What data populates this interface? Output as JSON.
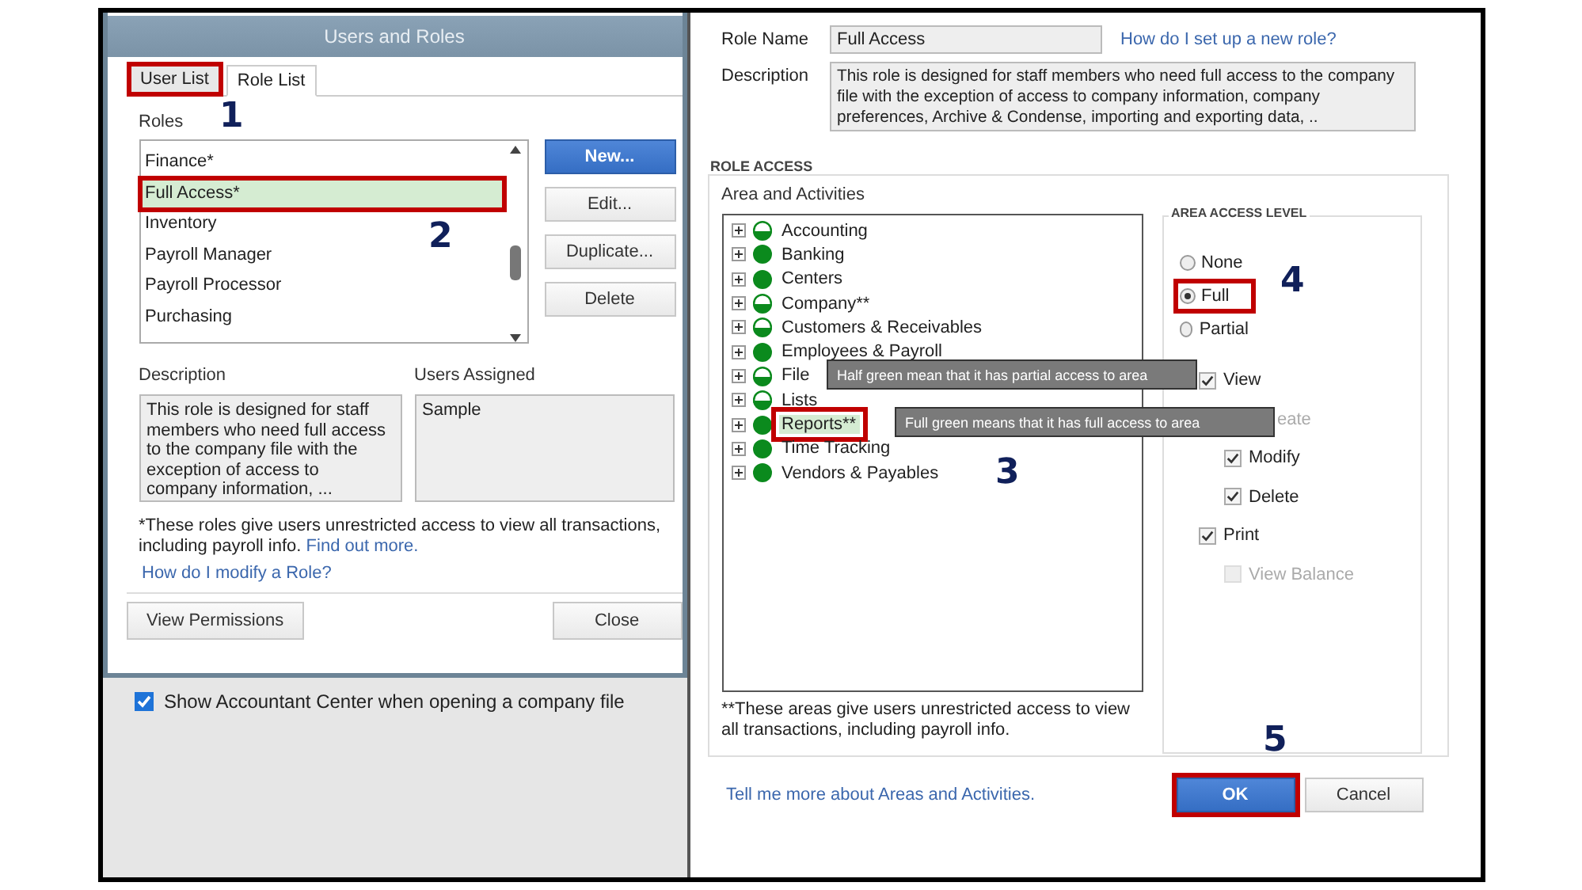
{
  "left_dialog": {
    "title": "Users and Roles",
    "tabs": [
      {
        "label": "User List",
        "selected": false,
        "highlighted": true,
        "step": "1"
      },
      {
        "label": "Role List",
        "selected": true,
        "highlighted": false
      }
    ],
    "roles_label": "Roles",
    "roles": [
      {
        "name": "Finance*",
        "selected": false
      },
      {
        "name": "Full Access*",
        "selected": true,
        "highlighted": true,
        "step": "2"
      },
      {
        "name": "Inventory",
        "selected": false
      },
      {
        "name": "Payroll Manager",
        "selected": false
      },
      {
        "name": "Payroll Processor",
        "selected": false
      },
      {
        "name": "Purchasing",
        "selected": false
      }
    ],
    "role_buttons": [
      {
        "label": "New...",
        "kind": "primary"
      },
      {
        "label": "Edit...",
        "kind": "default"
      },
      {
        "label": "Duplicate...",
        "kind": "default"
      },
      {
        "label": "Delete",
        "kind": "default"
      }
    ],
    "description_label": "Description",
    "description": "This role is designed for staff members who need full access to the company file with the exception of access to company information, ...",
    "users_assigned_label": "Users Assigned",
    "users_assigned": [
      "Sample"
    ],
    "footnote": "*These roles give users unrestricted access to view all transactions, including payroll info.",
    "footnote_link": "Find out more.",
    "help_link": "How do I modify a Role?",
    "bottom_buttons": [
      {
        "label": "View Permissions"
      },
      {
        "label": "Close"
      }
    ],
    "accountant_center": {
      "label": "Show Accountant Center when opening a company file",
      "checked": true
    }
  },
  "right_panel": {
    "role_name_label": "Role Name",
    "role_name": "Full Access",
    "setup_link": "How do I set up a new role?",
    "description_label": "Description",
    "description": "This role is designed for staff members who need full access to the company file with the exception of access to company information, company preferences, Archive & Condense, importing and exporting data, ..",
    "role_access_heading": "ROLE ACCESS",
    "areas_label": "Area and Activities",
    "areas": [
      {
        "name": "Accounting",
        "kind": "partial"
      },
      {
        "name": "Banking",
        "kind": "full"
      },
      {
        "name": "Centers",
        "kind": "full"
      },
      {
        "name": "Company**",
        "kind": "partial"
      },
      {
        "name": "Customers & Receivables",
        "kind": "partial"
      },
      {
        "name": "Employees & Payroll",
        "kind": "full"
      },
      {
        "name": "File",
        "kind": "partial",
        "tooltip": "Half green mean that it has partial access to area"
      },
      {
        "name": "Lists",
        "kind": "partial"
      },
      {
        "name": "Reports**",
        "kind": "full",
        "highlighted": true,
        "step": "3",
        "tooltip": "Full green means that it has full access to area"
      },
      {
        "name": "Time Tracking",
        "kind": "full"
      },
      {
        "name": "Vendors & Payables",
        "kind": "full"
      }
    ],
    "areas_footnote": "**These areas give users unrestricted access to view all transactions, including payroll info.",
    "access_level": {
      "heading": "AREA ACCESS LEVEL",
      "options": [
        {
          "label": "None",
          "selected": false
        },
        {
          "label": "Full",
          "selected": true,
          "highlighted": true,
          "step": "4"
        },
        {
          "label": "Partial",
          "selected": false
        }
      ],
      "permissions": [
        {
          "label": "View",
          "checked": true,
          "disabled": false,
          "children": [
            {
              "label": "eate",
              "disabled": true,
              "covered": true
            },
            {
              "label": "Modify",
              "checked": true,
              "disabled": false
            },
            {
              "label": "Delete",
              "checked": true,
              "disabled": false
            }
          ]
        },
        {
          "label": "Print",
          "checked": true,
          "disabled": false,
          "children": [
            {
              "label": "View Balance",
              "checked": false,
              "disabled": true
            }
          ]
        }
      ]
    },
    "help_link": "Tell me more about Areas and Activities.",
    "buttons": [
      {
        "label": "OK",
        "kind": "primary",
        "highlighted": true,
        "step": "5"
      },
      {
        "label": "Cancel",
        "kind": "default"
      }
    ]
  }
}
